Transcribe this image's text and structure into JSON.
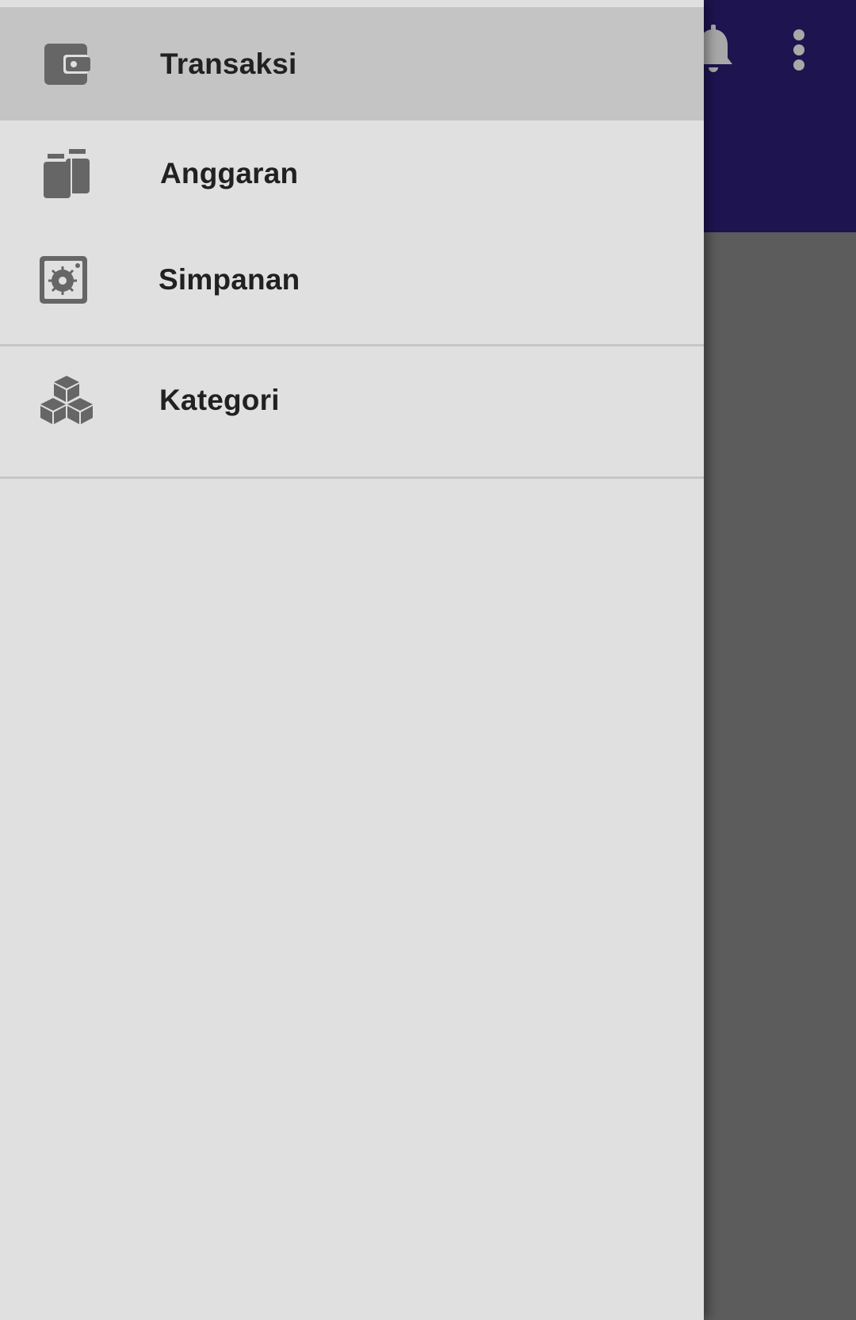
{
  "app_bar": {
    "background": "#1e1450",
    "actions": [
      {
        "icon": "bell-icon"
      },
      {
        "icon": "more-vert-icon"
      }
    ]
  },
  "drawer": {
    "active_item": "Transaksi",
    "active_background": "#c4c4c4",
    "background": "#e0e0e0",
    "groups": [
      {
        "items": [
          {
            "label": "Transaksi",
            "icon": "wallet-icon",
            "active": true
          },
          {
            "label": "Anggaran",
            "icon": "budget-icon",
            "active": false
          },
          {
            "label": "Simpanan",
            "icon": "safe-icon",
            "active": false
          }
        ]
      },
      {
        "items": [
          {
            "label": "Kategori",
            "icon": "cubes-icon",
            "active": false
          }
        ]
      }
    ]
  },
  "colors": {
    "scrim": "#5c5c5c",
    "icon": "#666666",
    "text": "#212121"
  }
}
